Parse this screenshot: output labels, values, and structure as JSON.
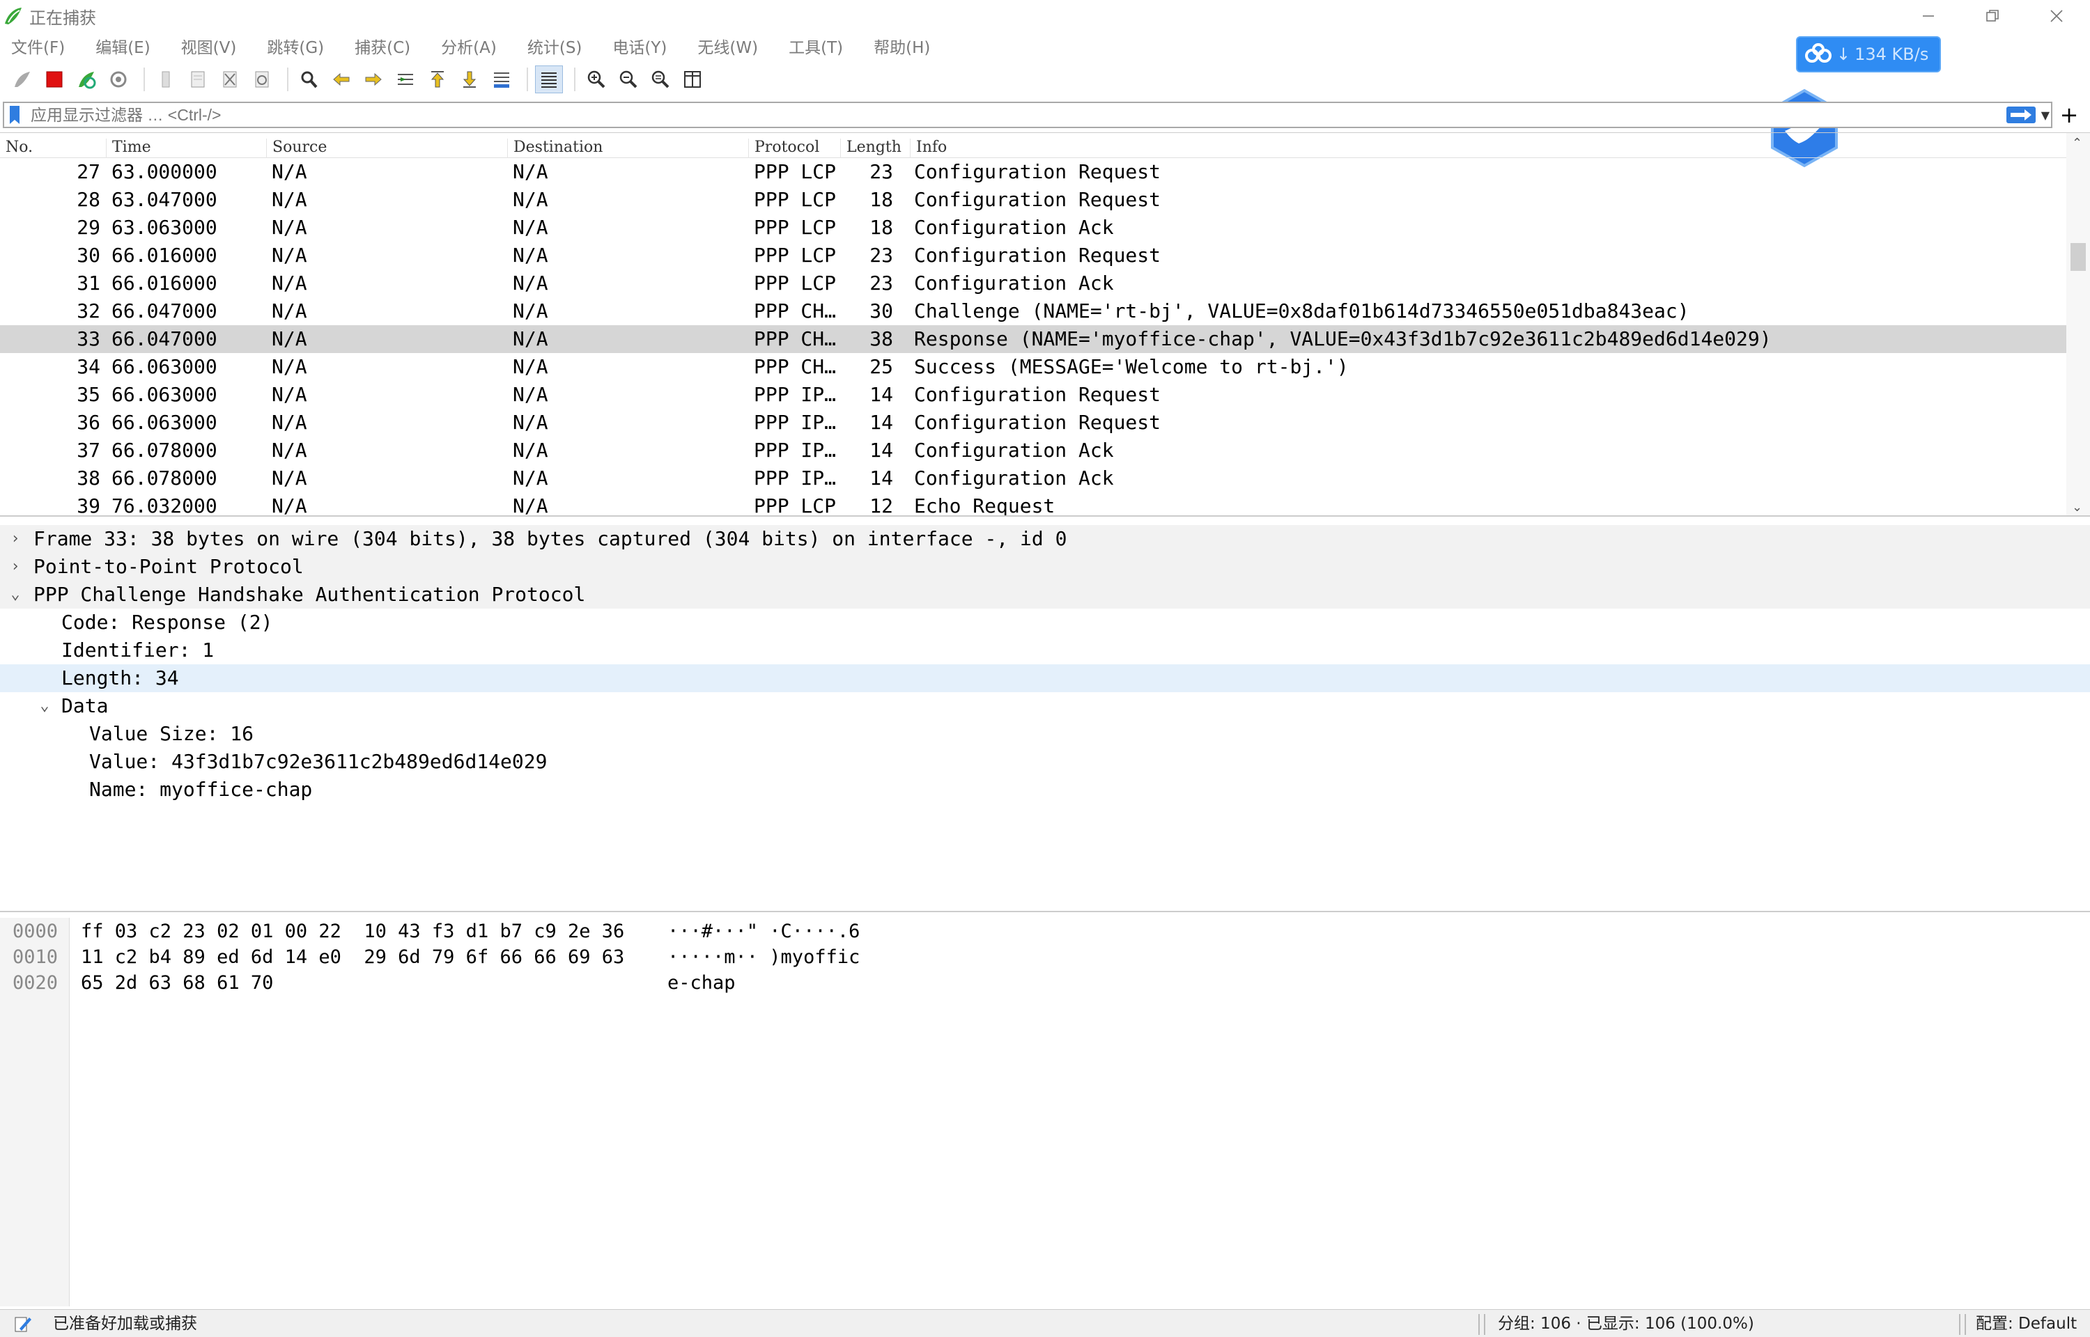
{
  "window": {
    "title": "正在捕获"
  },
  "menu": [
    "文件(F)",
    "编辑(E)",
    "视图(V)",
    "跳转(G)",
    "捕获(C)",
    "分析(A)",
    "统计(S)",
    "电话(Y)",
    "无线(W)",
    "工具(T)",
    "帮助(H)"
  ],
  "toolbar": {
    "icons": [
      "start-capture-icon",
      "stop-capture-icon",
      "restart-capture-icon",
      "capture-options-icon",
      "open-file-icon",
      "save-file-icon",
      "close-file-icon",
      "reload-file-icon",
      "find-packet-icon",
      "go-back-icon",
      "go-forward-icon",
      "go-to-packet-icon",
      "first-packet-icon",
      "last-packet-icon",
      "auto-scroll-icon",
      "colorize-icon",
      "zoom-in-icon",
      "zoom-out-icon",
      "normal-size-icon",
      "resize-columns-icon"
    ]
  },
  "net_widget": {
    "speed": "134 KB/s"
  },
  "filter": {
    "placeholder": "应用显示过滤器 … <Ctrl-/>"
  },
  "packet_list": {
    "columns": [
      "No.",
      "Time",
      "Source",
      "Destination",
      "Protocol",
      "Length",
      "Info"
    ],
    "rows": [
      {
        "no": "27",
        "time": "63.000000",
        "src": "N/A",
        "dst": "N/A",
        "proto": "PPP LCP",
        "len": "23",
        "info": "Configuration Request"
      },
      {
        "no": "28",
        "time": "63.047000",
        "src": "N/A",
        "dst": "N/A",
        "proto": "PPP LCP",
        "len": "18",
        "info": "Configuration Request"
      },
      {
        "no": "29",
        "time": "63.063000",
        "src": "N/A",
        "dst": "N/A",
        "proto": "PPP LCP",
        "len": "18",
        "info": "Configuration Ack"
      },
      {
        "no": "30",
        "time": "66.016000",
        "src": "N/A",
        "dst": "N/A",
        "proto": "PPP LCP",
        "len": "23",
        "info": "Configuration Request"
      },
      {
        "no": "31",
        "time": "66.016000",
        "src": "N/A",
        "dst": "N/A",
        "proto": "PPP LCP",
        "len": "23",
        "info": "Configuration Ack"
      },
      {
        "no": "32",
        "time": "66.047000",
        "src": "N/A",
        "dst": "N/A",
        "proto": "PPP CH…",
        "len": "30",
        "info": "Challenge (NAME='rt-bj', VALUE=0x8daf01b614d73346550e051dba843eac)"
      },
      {
        "no": "33",
        "time": "66.047000",
        "src": "N/A",
        "dst": "N/A",
        "proto": "PPP CH…",
        "len": "38",
        "info": "Response (NAME='myoffice-chap', VALUE=0x43f3d1b7c92e3611c2b489ed6d14e029)"
      },
      {
        "no": "34",
        "time": "66.063000",
        "src": "N/A",
        "dst": "N/A",
        "proto": "PPP CH…",
        "len": "25",
        "info": "Success (MESSAGE='Welcome to rt-bj.')"
      },
      {
        "no": "35",
        "time": "66.063000",
        "src": "N/A",
        "dst": "N/A",
        "proto": "PPP IP…",
        "len": "14",
        "info": "Configuration Request"
      },
      {
        "no": "36",
        "time": "66.063000",
        "src": "N/A",
        "dst": "N/A",
        "proto": "PPP IP…",
        "len": "14",
        "info": "Configuration Request"
      },
      {
        "no": "37",
        "time": "66.078000",
        "src": "N/A",
        "dst": "N/A",
        "proto": "PPP IP…",
        "len": "14",
        "info": "Configuration Ack"
      },
      {
        "no": "38",
        "time": "66.078000",
        "src": "N/A",
        "dst": "N/A",
        "proto": "PPP IP…",
        "len": "14",
        "info": "Configuration Ack"
      },
      {
        "no": "39",
        "time": "76.032000",
        "src": "N/A",
        "dst": "N/A",
        "proto": "PPP LCP",
        "len": "12",
        "info": "Echo Request"
      }
    ]
  },
  "detail": {
    "rows": [
      {
        "text": "Frame 33: 38 bytes on wire (304 bits), 38 bytes captured (304 bits) on interface -, id 0",
        "arrow": "›"
      },
      {
        "text": "Point-to-Point Protocol",
        "arrow": "›"
      },
      {
        "text": "PPP Challenge Handshake Authentication Protocol",
        "arrow": "⌄"
      },
      {
        "text": "Code: Response (2)",
        "arrow": ""
      },
      {
        "text": "Identifier: 1",
        "arrow": ""
      },
      {
        "text": "Length: 34",
        "arrow": ""
      },
      {
        "text": "Data",
        "arrow": "⌄"
      },
      {
        "text": "Value Size: 16",
        "arrow": ""
      },
      {
        "text": "Value: 43f3d1b7c92e3611c2b489ed6d14e029",
        "arrow": ""
      },
      {
        "text": "Name: myoffice-chap",
        "arrow": ""
      }
    ]
  },
  "hex": {
    "rows": [
      {
        "offset": "0000",
        "bytes": "ff 03 c2 23 02 01 00 22  10 43 f3 d1 b7 c9 2e 36",
        "ascii": "···#···\" ·C····.6"
      },
      {
        "offset": "0010",
        "bytes": "11 c2 b4 89 ed 6d 14 e0  29 6d 79 6f 66 66 69 63",
        "ascii": "·····m·· )myoffic"
      },
      {
        "offset": "0020",
        "bytes": "65 2d 63 68 61 70",
        "ascii": "e-chap"
      }
    ]
  },
  "status": {
    "ready": "已准备好加载或捕获",
    "packets": "分组: 106 · 已显示: 106 (100.0%)",
    "profile": "配置: Default"
  }
}
